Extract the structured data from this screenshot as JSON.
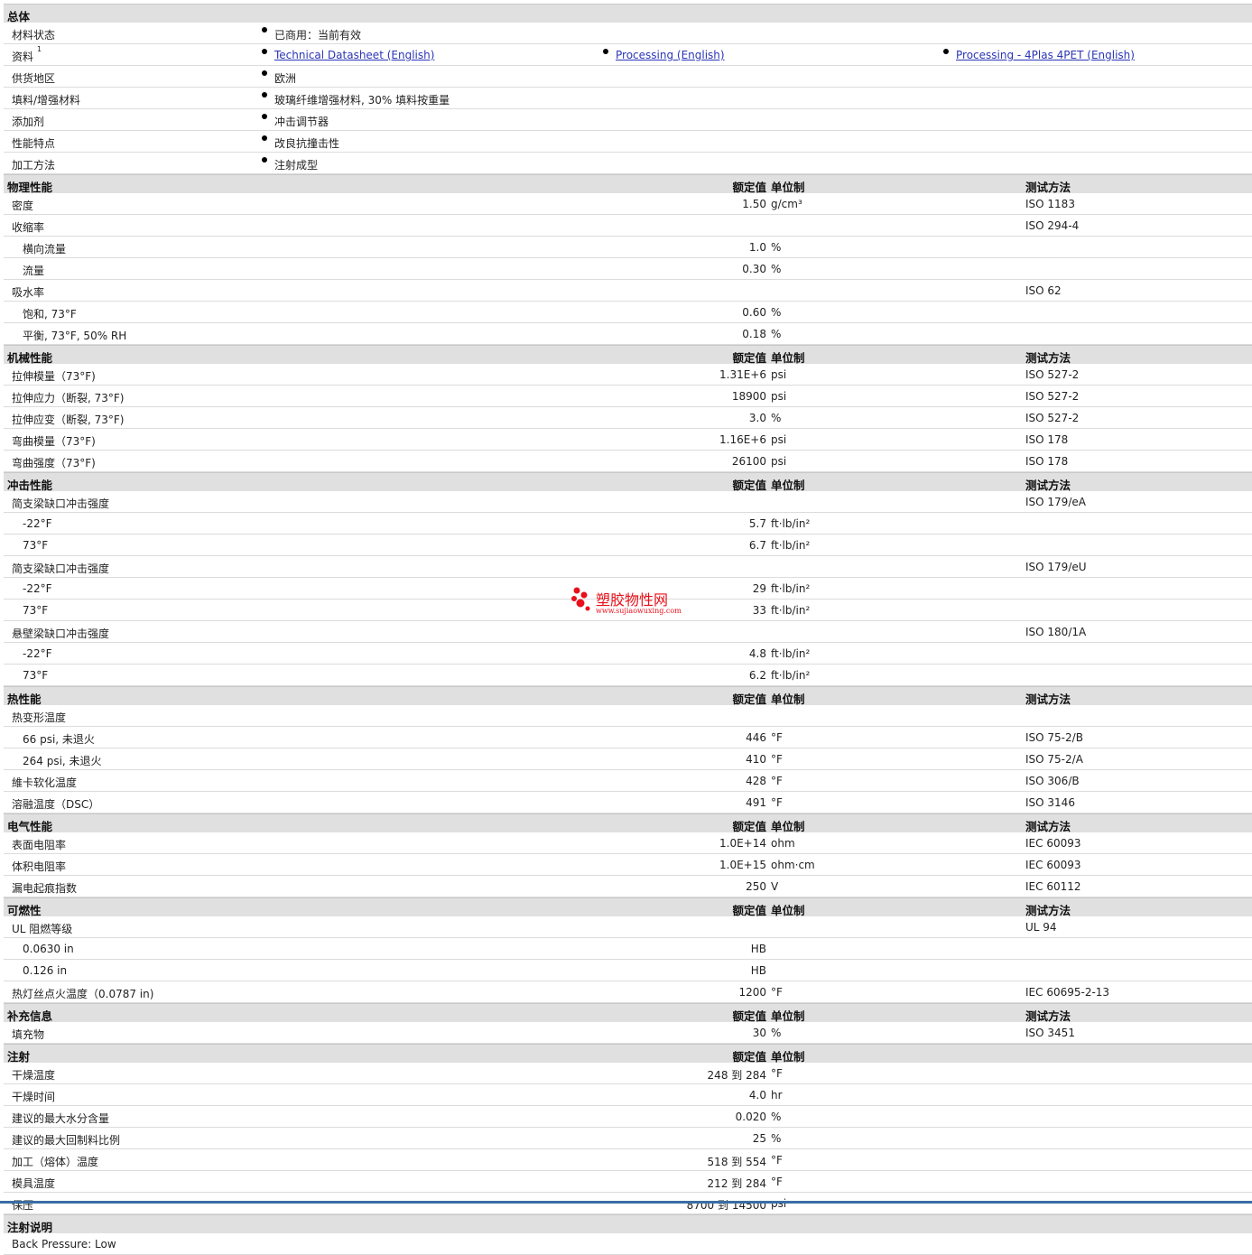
{
  "general": {
    "header": "总体",
    "rows": [
      {
        "label": "材料状态",
        "items": [
          "已商用：当前有效"
        ]
      },
      {
        "label": "资料",
        "sup": "1",
        "links": [
          "Technical Datasheet (English)",
          "Processing (English)",
          "Processing - 4Plas 4PET (English)"
        ]
      },
      {
        "label": "供货地区",
        "items": [
          "欧洲"
        ]
      },
      {
        "label": "填料/增强材料",
        "items": [
          "玻璃纤维增强材料, 30% 填料按重量"
        ]
      },
      {
        "label": "添加剂",
        "items": [
          "冲击调节器"
        ]
      },
      {
        "label": "性能特点",
        "items": [
          "改良抗撞击性"
        ]
      },
      {
        "label": "加工方法",
        "items": [
          "注射成型"
        ]
      }
    ]
  },
  "columns": {
    "value": "额定值",
    "unit": "单位制",
    "test": "测试方法"
  },
  "sections": [
    {
      "title": "物理性能",
      "test_col": true,
      "rows": [
        {
          "label": "密度",
          "value": "1.50",
          "unit": "g/cm³",
          "test": "ISO 1183"
        },
        {
          "label": "收缩率",
          "value": "",
          "unit": "",
          "test": "ISO 294-4"
        },
        {
          "label": "横向流量",
          "sub": true,
          "value": "1.0",
          "unit": "%",
          "test": ""
        },
        {
          "label": "流量",
          "sub": true,
          "value": "0.30",
          "unit": "%",
          "test": ""
        },
        {
          "label": "吸水率",
          "value": "",
          "unit": "",
          "test": "ISO 62"
        },
        {
          "label": "饱和, 73°F",
          "sub": true,
          "value": "0.60",
          "unit": "%",
          "test": ""
        },
        {
          "label": "平衡, 73°F, 50% RH",
          "sub": true,
          "value": "0.18",
          "unit": "%",
          "test": ""
        }
      ]
    },
    {
      "title": "机械性能",
      "test_col": true,
      "rows": [
        {
          "label": "拉伸模量（73°F)",
          "value": "1.31E+6",
          "unit": "psi",
          "test": "ISO 527-2"
        },
        {
          "label": "拉伸应力（断裂, 73°F)",
          "value": "18900",
          "unit": "psi",
          "test": "ISO 527-2"
        },
        {
          "label": "拉伸应变（断裂, 73°F)",
          "value": "3.0",
          "unit": "%",
          "test": "ISO 527-2"
        },
        {
          "label": "弯曲模量（73°F)",
          "value": "1.16E+6",
          "unit": "psi",
          "test": "ISO 178"
        },
        {
          "label": "弯曲强度（73°F)",
          "value": "26100",
          "unit": "psi",
          "test": "ISO 178"
        }
      ]
    },
    {
      "title": "冲击性能",
      "test_col": true,
      "rows": [
        {
          "label": "简支梁缺口冲击强度",
          "value": "",
          "unit": "",
          "test": "ISO 179/eA"
        },
        {
          "label": "-22°F",
          "sub": true,
          "value": "5.7",
          "unit": "ft·lb/in²",
          "test": ""
        },
        {
          "label": "73°F",
          "sub": true,
          "value": "6.7",
          "unit": "ft·lb/in²",
          "test": ""
        },
        {
          "label": "简支梁缺口冲击强度",
          "value": "",
          "unit": "",
          "test": "ISO 179/eU"
        },
        {
          "label": "-22°F",
          "sub": true,
          "value": "29",
          "unit": "ft·lb/in²",
          "test": ""
        },
        {
          "label": "73°F",
          "sub": true,
          "value": "33",
          "unit": "ft·lb/in²",
          "test": ""
        },
        {
          "label": "悬壁梁缺口冲击强度",
          "value": "",
          "unit": "",
          "test": "ISO 180/1A"
        },
        {
          "label": "-22°F",
          "sub": true,
          "value": "4.8",
          "unit": "ft·lb/in²",
          "test": ""
        },
        {
          "label": "73°F",
          "sub": true,
          "value": "6.2",
          "unit": "ft·lb/in²",
          "test": ""
        }
      ]
    },
    {
      "title": "热性能",
      "test_col": true,
      "rows": [
        {
          "label": "热变形温度",
          "value": "",
          "unit": "",
          "test": ""
        },
        {
          "label": "66 psi, 未退火",
          "sub": true,
          "value": "446",
          "unit": "°F",
          "test": "ISO 75-2/B"
        },
        {
          "label": "264 psi, 未退火",
          "sub": true,
          "value": "410",
          "unit": "°F",
          "test": "ISO 75-2/A"
        },
        {
          "label": "維卡软化温度",
          "value": "428",
          "unit": "°F",
          "test": "ISO 306/B"
        },
        {
          "label": "溶融温度（DSC）",
          "value": "491",
          "unit": "°F",
          "test": "ISO 3146"
        }
      ]
    },
    {
      "title": "电气性能",
      "test_col": true,
      "rows": [
        {
          "label": "表面电阻率",
          "value": "1.0E+14",
          "unit": "ohm",
          "test": "IEC 60093"
        },
        {
          "label": "体积电阻率",
          "value": "1.0E+15",
          "unit": "ohm·cm",
          "test": "IEC 60093"
        },
        {
          "label": "漏电起痕指数",
          "value": "250",
          "unit": "V",
          "test": "IEC 60112"
        }
      ]
    },
    {
      "title": "可燃性",
      "test_col": true,
      "rows": [
        {
          "label": "UL 阻燃等级",
          "value": "",
          "unit": "",
          "test": "UL 94"
        },
        {
          "label": "0.0630 in",
          "sub": true,
          "value": "HB",
          "unit": "",
          "test": ""
        },
        {
          "label": "0.126 in",
          "sub": true,
          "value": "HB",
          "unit": "",
          "test": ""
        },
        {
          "label": "热灯丝点火温度（0.0787 in)",
          "value": "1200",
          "unit": "°F",
          "test": "IEC 60695-2-13"
        }
      ]
    },
    {
      "title": "补充信息",
      "test_col": true,
      "rows": [
        {
          "label": "填充物",
          "value": "30",
          "unit": "%",
          "test": "ISO 3451"
        }
      ]
    },
    {
      "title": "注射",
      "test_col": false,
      "rows": [
        {
          "label": "干燥温度",
          "value": "248 到  284",
          "unit": "°F",
          "test": ""
        },
        {
          "label": "干燥时间",
          "value": "4.0",
          "unit": "hr",
          "test": ""
        },
        {
          "label": "建议的最大水分含量",
          "value": "0.020",
          "unit": "%",
          "test": ""
        },
        {
          "label": "建议的最大回制料比例",
          "value": "25",
          "unit": "%",
          "test": ""
        },
        {
          "label": "加工（熔体）温度",
          "value": "518 到  554",
          "unit": "°F",
          "test": ""
        },
        {
          "label": "模具温度",
          "value": "212 到  284",
          "unit": "°F",
          "test": ""
        },
        {
          "label": "保压",
          "value": "8700 到  14500",
          "unit": "psi",
          "test": ""
        }
      ]
    }
  ],
  "notes": {
    "title": "注射说明",
    "rows": [
      "Back Pressure: Low"
    ]
  },
  "watermark": {
    "name": "塑胶物性网",
    "url": "www.sujiaowuxing.com"
  }
}
